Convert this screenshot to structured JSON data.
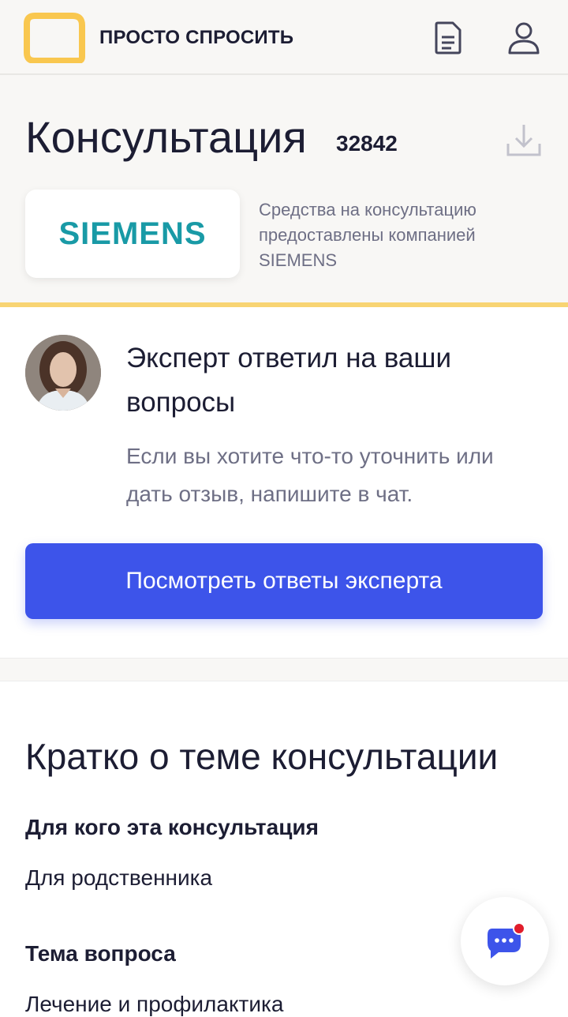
{
  "app": {
    "brand": "ПРОСТО СПРОСИТЬ",
    "icons": {
      "logo": "chat-bubble-logo",
      "documents": "document-icon",
      "profile": "user-icon",
      "download": "download-icon",
      "chat": "chat-icon"
    }
  },
  "header": {
    "title": "Консультация",
    "number": "32842",
    "sponsor_logo": "SIEMENS",
    "sponsor_text": "Средства на консультацию предоставлены компанией SIEMENS"
  },
  "expert_card": {
    "title": "Эксперт ответил на ваши вопросы",
    "subtitle": "Если вы хотите что-то уточнить или дать отзыв, напишите в чат.",
    "button": "Посмотреть ответы эксперта"
  },
  "summary": {
    "title": "Кратко о теме консультации",
    "items": [
      {
        "label": "Для кого эта консультация",
        "value": "Для родственника"
      },
      {
        "label": "Тема вопроса",
        "value": "Лечение и профилактика"
      }
    ]
  },
  "colors": {
    "accent": "#3d54ea",
    "logo_yellow": "#f9c74f",
    "divider_yellow": "#f8d473",
    "sponsor_teal": "#199aa6",
    "notification_red": "#e11d2b"
  }
}
